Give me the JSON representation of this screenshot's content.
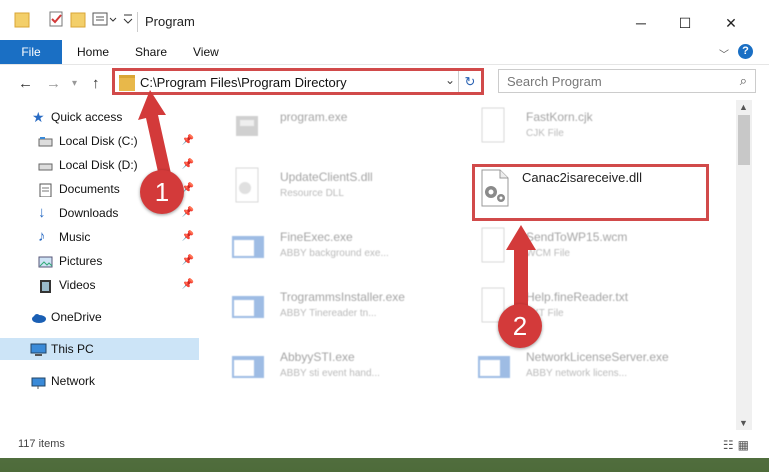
{
  "window": {
    "title": "Program",
    "controls": {
      "minimize": "─",
      "maximize": "☐",
      "close": "✕"
    }
  },
  "ribbon": {
    "tabs": [
      "File",
      "Home",
      "Share",
      "View"
    ],
    "help": "?"
  },
  "navbar": {
    "address": "C:\\Program Files\\Program Directory",
    "search_placeholder": "Search Program"
  },
  "sidebar": {
    "items": [
      {
        "label": "Quick access",
        "icon": "star-icon",
        "pinned": false
      },
      {
        "label": "Local Disk (C:)",
        "icon": "drive-icon",
        "pinned": true
      },
      {
        "label": "Local Disk (D:)",
        "icon": "drive-icon",
        "pinned": true
      },
      {
        "label": "Documents",
        "icon": "documents-icon",
        "pinned": true
      },
      {
        "label": "Downloads",
        "icon": "download-icon",
        "pinned": true
      },
      {
        "label": "Music",
        "icon": "music-icon",
        "pinned": true
      },
      {
        "label": "Pictures",
        "icon": "pictures-icon",
        "pinned": true
      },
      {
        "label": "Videos",
        "icon": "videos-icon",
        "pinned": true
      },
      {
        "label": "OneDrive",
        "icon": "cloud-icon",
        "pinned": false
      },
      {
        "label": "This PC",
        "icon": "pc-icon",
        "pinned": false,
        "selected": true
      },
      {
        "label": "Network",
        "icon": "network-icon",
        "pinned": false
      }
    ]
  },
  "files": [
    {
      "name": "program.exe",
      "type": "",
      "icon": "exe-icon"
    },
    {
      "name": "FastKorn.cjk",
      "type": "CJK File",
      "icon": "file-icon"
    },
    {
      "name": "UpdateClientS.dll",
      "type": "Resource DLL",
      "icon": "dll-icon"
    },
    {
      "name": "Canac2isareceive.dll",
      "type": "",
      "icon": "dll-icon",
      "highlighted": true
    },
    {
      "name": "FineExec.exe",
      "type": "ABBY background exe...",
      "icon": "app-icon"
    },
    {
      "name": "SendToWP15.wcm",
      "type": "WCM File",
      "icon": "file-icon"
    },
    {
      "name": "TrogrammsInstaller.exe",
      "type": "ABBY Tinereader tn...",
      "icon": "app-icon"
    },
    {
      "name": "Help.fineReader.txt",
      "type": "TXT File",
      "icon": "file-icon"
    },
    {
      "name": "AbbyySTI.exe",
      "type": "ABBY sti event hand...",
      "icon": "app-icon"
    },
    {
      "name": "NetworkLicenseServer.exe",
      "type": "ABBY network licens...",
      "icon": "app-icon"
    }
  ],
  "status": {
    "item_count": "117 items"
  },
  "annotations": {
    "step1": "1",
    "step2": "2",
    "color": "#d33a3a"
  }
}
